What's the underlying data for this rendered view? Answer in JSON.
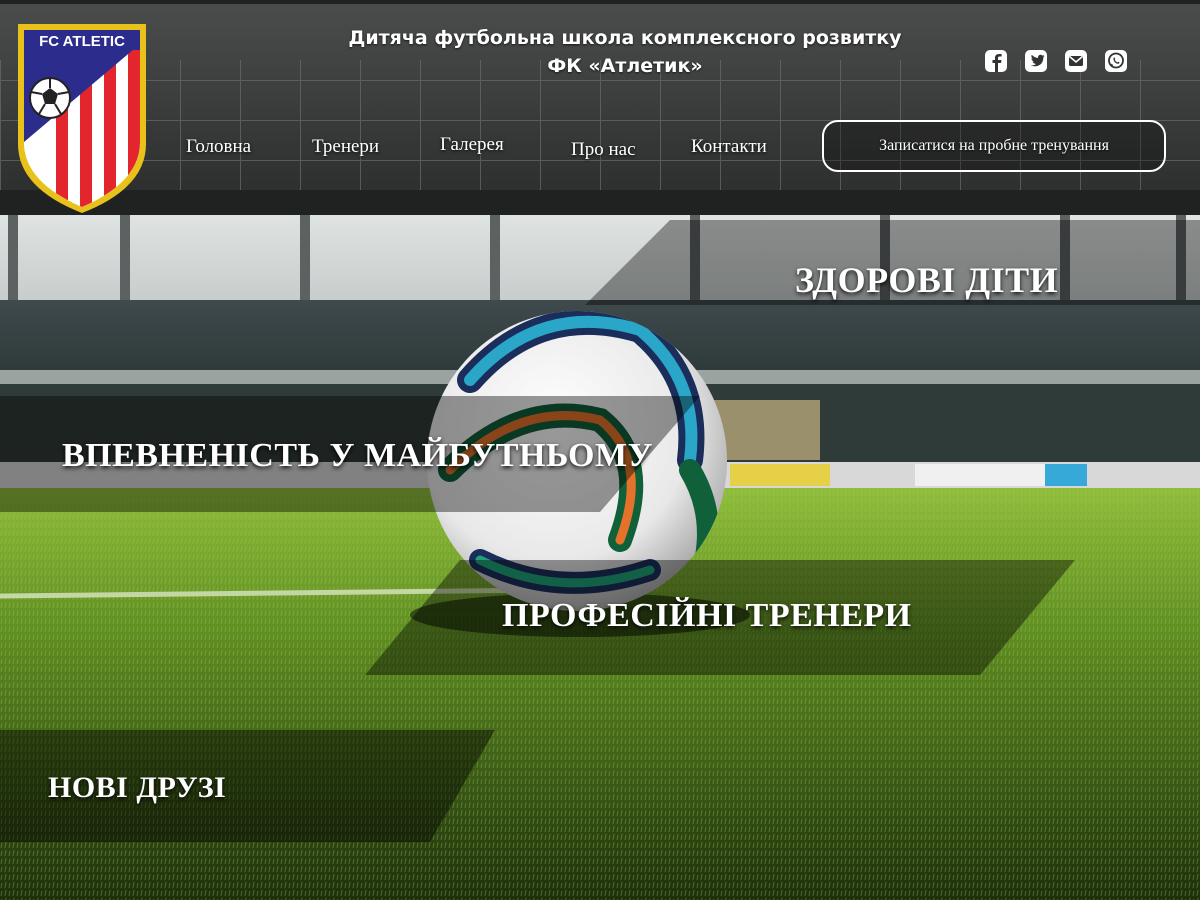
{
  "header": {
    "logo_text": "FC ATLETIC",
    "title_line1": "Дитяча футбольна школа комплексного розвитку",
    "title_line2": "ФК «Атлетик»"
  },
  "social": [
    {
      "name": "facebook-icon"
    },
    {
      "name": "twitter-icon"
    },
    {
      "name": "mail-icon"
    },
    {
      "name": "whatsapp-icon"
    }
  ],
  "nav": {
    "items": [
      {
        "label": "Головна"
      },
      {
        "label": "Тренери"
      },
      {
        "label": "Галерея"
      },
      {
        "label": "Про нас"
      },
      {
        "label": "Контакти"
      }
    ],
    "cta_label": "Записатися на пробне тренування"
  },
  "slogans": [
    {
      "text": "ЗДОРОВІ ДІТИ"
    },
    {
      "text": "ВПЕВНЕНІСТЬ У МАЙБУТНЬОМУ"
    },
    {
      "text": "ПРОФЕСІЙНІ ТРЕНЕРИ"
    },
    {
      "text": "НОВІ ДРУЗІ"
    }
  ],
  "colors": {
    "logo_red": "#e3262e",
    "logo_blue": "#2c2c8c",
    "logo_gold": "#e8c21a",
    "text": "#ffffff"
  }
}
